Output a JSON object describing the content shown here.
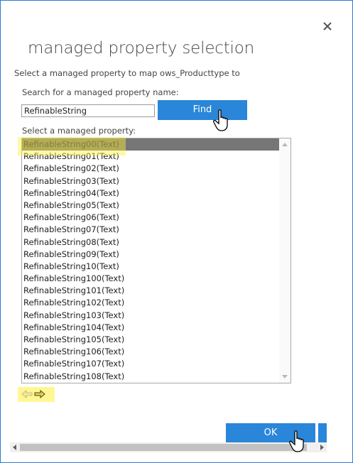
{
  "dialog": {
    "title": "managed property selection",
    "instruction": "Select a managed property to map ows_Producttype to",
    "close_icon": "close-icon"
  },
  "search": {
    "label": "Search for a managed property name:",
    "value": "RefinableString",
    "find_label": "Find"
  },
  "list": {
    "label": "Select a managed property:",
    "selected_index": 0,
    "items": [
      "RefinableString00(Text)",
      "RefinableString01(Text)",
      "RefinableString02(Text)",
      "RefinableString03(Text)",
      "RefinableString04(Text)",
      "RefinableString05(Text)",
      "RefinableString06(Text)",
      "RefinableString07(Text)",
      "RefinableString08(Text)",
      "RefinableString09(Text)",
      "RefinableString10(Text)",
      "RefinableString100(Text)",
      "RefinableString101(Text)",
      "RefinableString102(Text)",
      "RefinableString103(Text)",
      "RefinableString104(Text)",
      "RefinableString105(Text)",
      "RefinableString106(Text)",
      "RefinableString107(Text)",
      "RefinableString108(Text)"
    ]
  },
  "pager": {
    "prev_icon": "arrow-left-icon",
    "next_icon": "arrow-right-icon"
  },
  "footer": {
    "ok_label": "OK"
  },
  "colors": {
    "accent": "#2a86d9",
    "selection": "#767676",
    "highlight": "#fff03c"
  }
}
